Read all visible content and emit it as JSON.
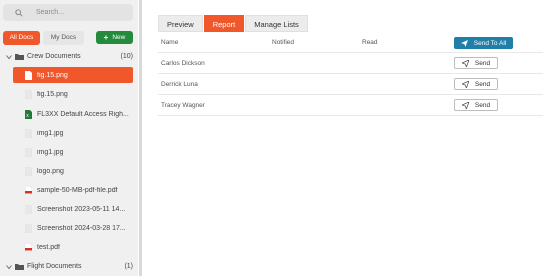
{
  "search": {
    "placeholder": "Search..."
  },
  "doc_tabs": {
    "all": "All Docs",
    "my": "My Docs"
  },
  "new_button": {
    "label": "New"
  },
  "folders": [
    {
      "name": "Crew Documents",
      "count": "(10)"
    },
    {
      "name": "Flight Documents",
      "count": "(1)"
    }
  ],
  "files": [
    {
      "name": "fig.15.png",
      "icon": "image-file-icon"
    },
    {
      "name": "fig.15.png",
      "icon": "image-file-icon"
    },
    {
      "name": "FL3XX Default Access Righ...",
      "icon": "excel-file-icon"
    },
    {
      "name": "img1.jpg",
      "icon": "image-file-icon"
    },
    {
      "name": "img1.jpg",
      "icon": "image-file-icon"
    },
    {
      "name": "logo.png",
      "icon": "image-file-icon"
    },
    {
      "name": "sample-50-MB-pdf-file.pdf",
      "icon": "pdf-file-icon"
    },
    {
      "name": "Screenshot 2023-05-11 14...",
      "icon": "image-file-icon"
    },
    {
      "name": "Screenshot 2024-03-28 17...",
      "icon": "image-file-icon"
    },
    {
      "name": "test.pdf",
      "icon": "pdf-file-icon"
    }
  ],
  "main_tabs": [
    "Preview",
    "Report",
    "Manage Lists"
  ],
  "table": {
    "headers": {
      "name": "Name",
      "notified": "Notified",
      "read": "Read"
    },
    "send_all_label": "Send To All",
    "rows": [
      {
        "name": "Carlos Dickson",
        "send_label": "Send"
      },
      {
        "name": "Derrick Luna",
        "send_label": "Send"
      },
      {
        "name": "Tracey Wagner",
        "send_label": "Send"
      }
    ]
  },
  "colors": {
    "accent": "#f0572a",
    "new_green": "#258a3c",
    "send_all_blue": "#1f7fa8"
  }
}
